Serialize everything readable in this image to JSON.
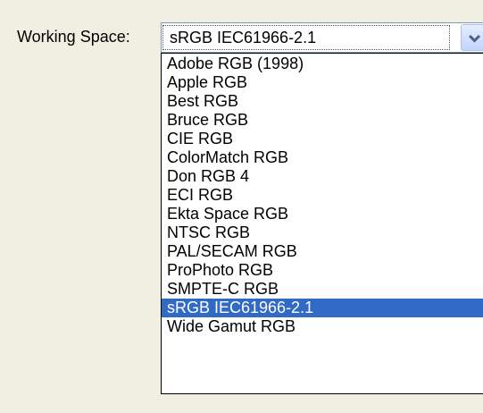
{
  "working_space": {
    "label": "Working Space:",
    "selected_value": "sRGB IEC61966-2.1",
    "options": [
      "Adobe RGB (1998)",
      "Apple RGB",
      "Best RGB",
      "Bruce RGB",
      "CIE RGB",
      "ColorMatch RGB",
      "Don RGB 4",
      "ECI RGB",
      "Ekta Space RGB",
      "NTSC RGB",
      "PAL/SECAM RGB",
      "ProPhoto RGB",
      "SMPTE-C RGB",
      "sRGB IEC61966-2.1",
      "Wide Gamut RGB"
    ],
    "highlighted_index": 13,
    "dropdown_icon": "chevron-down-icon"
  },
  "colors": {
    "window_background": "#f1efe2",
    "highlight": "#316ac5",
    "highlight_text": "#ffffff",
    "combo_border": "#7f9db9"
  }
}
